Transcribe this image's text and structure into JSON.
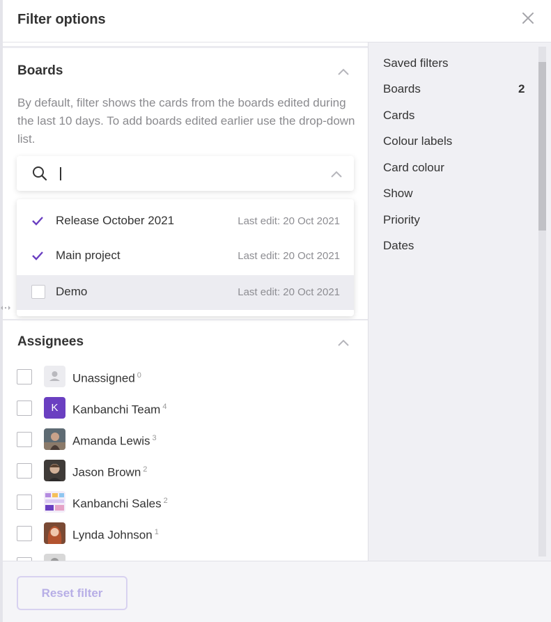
{
  "header": {
    "title": "Filter options"
  },
  "boards_section": {
    "title": "Boards",
    "description": "By default, filter shows the cards from the boards edited during the last 10 days. To add boards edited earlier use the drop-down list.",
    "search": {
      "value": "",
      "placeholder": ""
    },
    "items": [
      {
        "name": "Release October 2021",
        "last_edit": "Last edit: 20 Oct 2021",
        "checked": true
      },
      {
        "name": "Main project",
        "last_edit": "Last edit: 20 Oct 2021",
        "checked": true
      },
      {
        "name": "Demo",
        "last_edit": "Last edit: 20 Oct 2021",
        "checked": false
      }
    ]
  },
  "assignees_section": {
    "title": "Assignees",
    "items": [
      {
        "name": "Unassigned",
        "count": "0"
      },
      {
        "name": "Kanbanchi Team",
        "count": "4",
        "avatar_letter": "K"
      },
      {
        "name": "Amanda Lewis",
        "count": "3"
      },
      {
        "name": "Jason Brown",
        "count": "2"
      },
      {
        "name": "Kanbanchi Sales",
        "count": "2"
      },
      {
        "name": "Lynda Johnson",
        "count": "1"
      }
    ]
  },
  "sidebar": {
    "items": [
      {
        "label": "Saved filters"
      },
      {
        "label": "Boards",
        "badge": "2"
      },
      {
        "label": "Cards"
      },
      {
        "label": "Colour labels"
      },
      {
        "label": "Card colour"
      },
      {
        "label": "Show"
      },
      {
        "label": "Priority"
      },
      {
        "label": "Dates"
      }
    ]
  },
  "footer": {
    "reset_label": "Reset filter"
  },
  "colors": {
    "accent": "#6a3fc1",
    "badge": "#6a3fc1"
  }
}
